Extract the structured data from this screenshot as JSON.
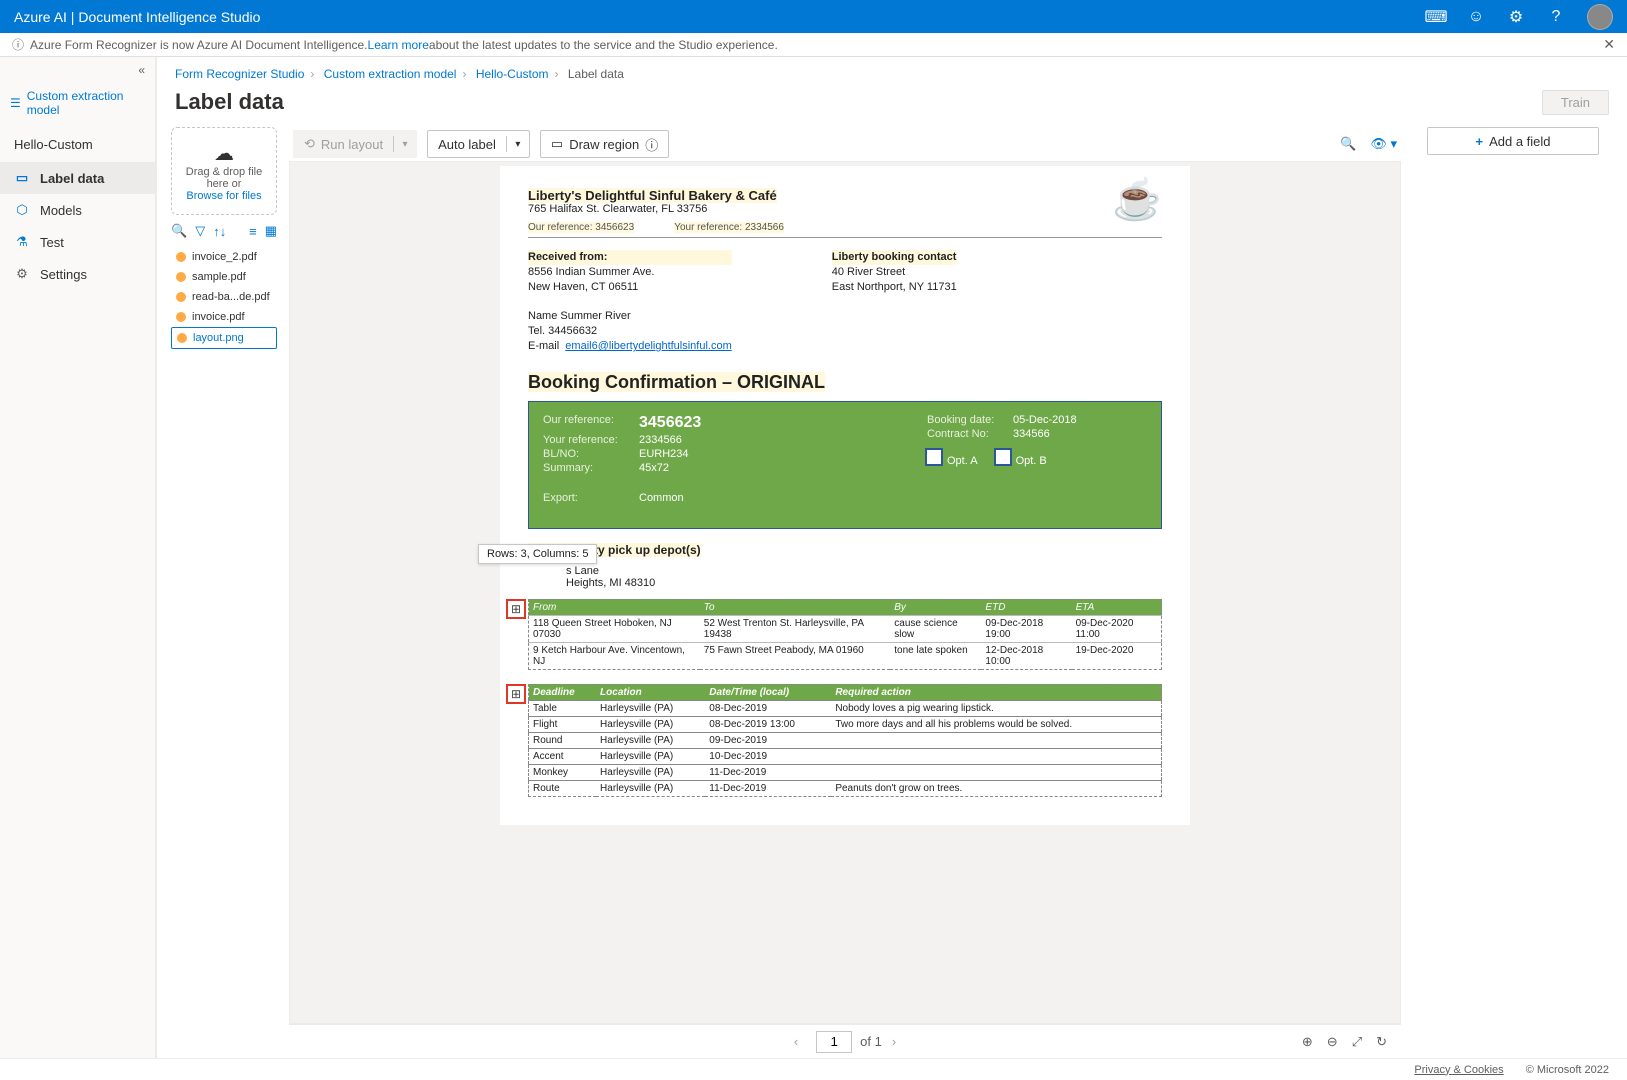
{
  "topbar": {
    "title": "Azure AI | Document Intelligence Studio"
  },
  "banner": {
    "pre": "Azure Form Recognizer is now Azure AI Document Intelligence. ",
    "link": "Learn more",
    "post": " about the latest updates to the service and the Studio experience."
  },
  "sidebar": {
    "header": "Custom extraction model",
    "project": "Hello-Custom",
    "items": [
      {
        "label": "Label data",
        "icon": "▭",
        "active": true
      },
      {
        "label": "Models",
        "icon": "⬡"
      },
      {
        "label": "Test",
        "icon": "⚗"
      },
      {
        "label": "Settings",
        "icon": "⚙"
      }
    ]
  },
  "breadcrumb": [
    {
      "label": "Form Recognizer Studio",
      "link": true
    },
    {
      "label": "Custom extraction model",
      "link": true
    },
    {
      "label": "Hello-Custom",
      "link": true
    },
    {
      "label": "Label data",
      "link": false
    }
  ],
  "page": {
    "title": "Label data",
    "train": "Train"
  },
  "dropzone": {
    "line1": "Drag & drop file here or",
    "browse": "Browse for files"
  },
  "files": [
    {
      "name": "invoice_2.pdf"
    },
    {
      "name": "sample.pdf"
    },
    {
      "name": "read-ba...de.pdf"
    },
    {
      "name": "invoice.pdf"
    },
    {
      "name": "layout.png",
      "selected": true
    }
  ],
  "toolbar": {
    "run_layout": "Run layout",
    "auto_label": "Auto label",
    "draw_region": "Draw region"
  },
  "rightcol": {
    "add_field": "Add a field"
  },
  "tooltip": "Rows: 3, Columns: 5",
  "doc": {
    "company": "Liberty's Delightful Sinful Bakery & Café",
    "addr": "765 Halifax St. Clearwater, FL 33756",
    "our_ref_lbl": "Our reference: 3456623",
    "your_ref_lbl": "Your reference: 2334566",
    "received_hdr": "Received from:",
    "received_addr1": "8556 Indian Summer Ave.",
    "received_addr2": "New Haven, CT 06511",
    "contact_hdr": "Liberty booking contact",
    "contact_addr1": "40 River Street",
    "contact_addr2": "East Northport, NY 11731",
    "name": "Name Summer River",
    "tel": "Tel. 34456632",
    "email_lbl": "E-mail",
    "email_val": "email6@libertydelightfulsinful.com",
    "title": "Booking Confirmation – ORIGINAL",
    "gb": {
      "our_ref_l": "Our reference:",
      "our_ref_v": "3456623",
      "your_ref_l": "Your reference:",
      "your_ref_v": "2334566",
      "blno_l": "BL/NO:",
      "blno_v": "EURH234",
      "summary_l": "Summary:",
      "summary_v": "45x72",
      "export_l": "Export:",
      "export_v": "Common",
      "bdate_l": "Booking date:",
      "bdate_v": "05-Dec-2018",
      "cno_l": "Contract No:",
      "cno_v": "334566",
      "opt_a": "Opt. A",
      "opt_b": "Opt. B"
    },
    "depot_hdr": "Export empty pick up depot(s)",
    "depot_l1": "s Lane",
    "depot_l2": "Heights, MI 48310",
    "table1": {
      "headers": [
        "From",
        "To",
        "By",
        "ETD",
        "ETA"
      ],
      "rows": [
        [
          "118 Queen Street Hoboken, NJ 07030",
          "52 West Trenton St. Harleysville, PA 19438",
          "cause science slow",
          "09-Dec-2018 19:00",
          "09-Dec-2020 11:00"
        ],
        [
          "9 Ketch Harbour Ave. Vincentown, NJ",
          "75 Fawn Street Peabody, MA 01960",
          "tone late spoken",
          "12-Dec-2018 10:00",
          "19-Dec-2020"
        ]
      ]
    },
    "table2": {
      "headers": [
        "Deadline",
        "Location",
        "Date/Time (local)",
        "Required action"
      ],
      "rows": [
        [
          "Table",
          "Harleysville (PA)",
          "08-Dec-2019",
          "Nobody loves a pig wearing lipstick."
        ],
        [
          "Flight",
          "Harleysville (PA)",
          "08-Dec-2019 13:00",
          "Two more days and all his problems would be solved."
        ],
        [
          "Round",
          "Harleysville (PA)",
          "09-Dec-2019",
          ""
        ],
        [
          "Accent",
          "Harleysville (PA)",
          "10-Dec-2019",
          ""
        ],
        [
          "Monkey",
          "Harleysville (PA)",
          "11-Dec-2019",
          ""
        ],
        [
          "Route",
          "Harleysville (PA)",
          "11-Dec-2019",
          "Peanuts don't grow on trees."
        ]
      ]
    }
  },
  "pager": {
    "current": "1",
    "of": "of 1"
  },
  "footer": {
    "privacy": "Privacy & Cookies",
    "copyright": "© Microsoft 2022"
  }
}
